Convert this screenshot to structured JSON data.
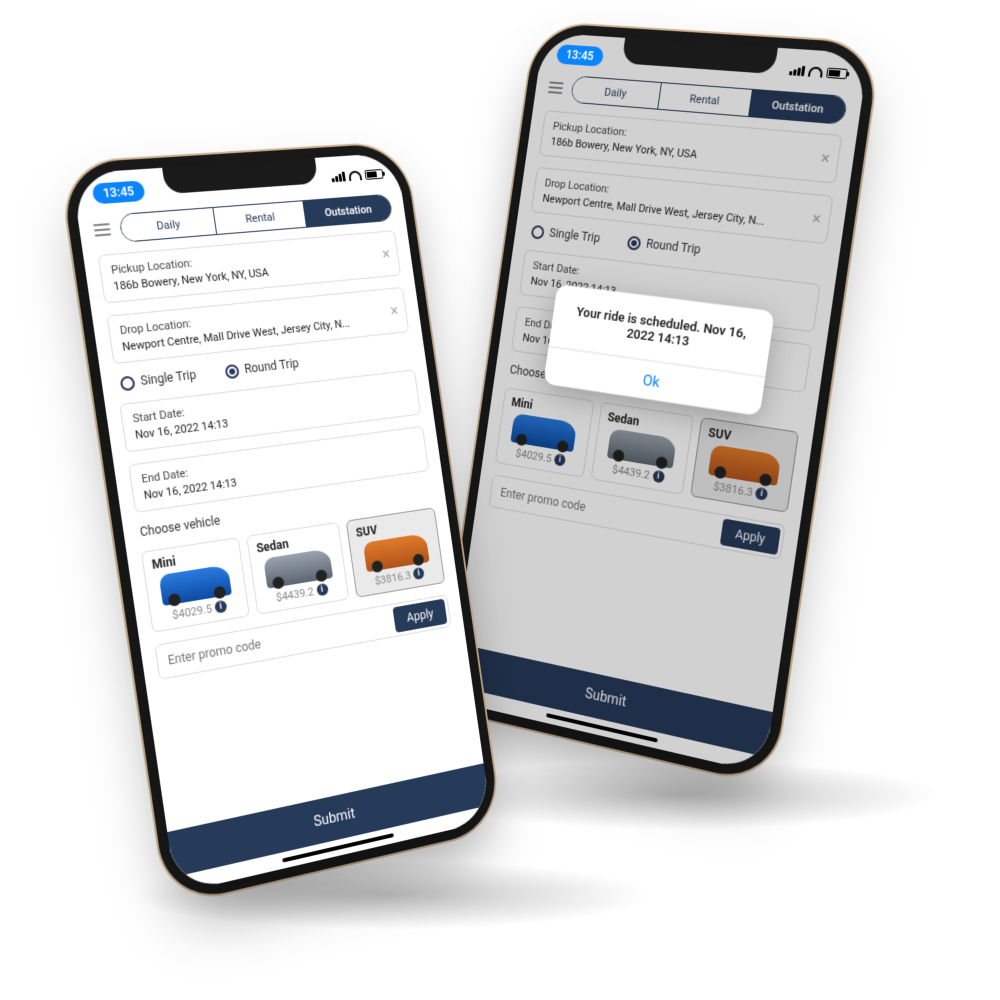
{
  "status": {
    "time": "13:45"
  },
  "tabs": {
    "daily": "Daily",
    "rental": "Rental",
    "outstation": "Outstation"
  },
  "pickup": {
    "label": "Pickup Location:",
    "value": "186b Bowery, New York, NY, USA"
  },
  "drop": {
    "label": "Drop Location:",
    "value": "Newport Centre, Mall Drive West, Jersey City, N..."
  },
  "trip": {
    "single": "Single Trip",
    "round": "Round Trip"
  },
  "start": {
    "label": "Start Date:",
    "value": "Nov 16, 2022 14:13"
  },
  "end": {
    "label": "End Date:",
    "value": "Nov 16, 2022 14:13"
  },
  "choose": "Choose vehicle",
  "vehicles": {
    "mini": {
      "name": "Mini",
      "price": "$4029.5"
    },
    "sedan": {
      "name": "Sedan",
      "price": "$4439.2"
    },
    "suv": {
      "name": "SUV",
      "price": "$3816.3"
    }
  },
  "promo": {
    "placeholder": "Enter promo code",
    "apply": "Apply"
  },
  "submit": "Submit",
  "alert": {
    "message": "Your ride is scheduled. Nov 16, 2022 14:13",
    "ok": "Ok"
  }
}
